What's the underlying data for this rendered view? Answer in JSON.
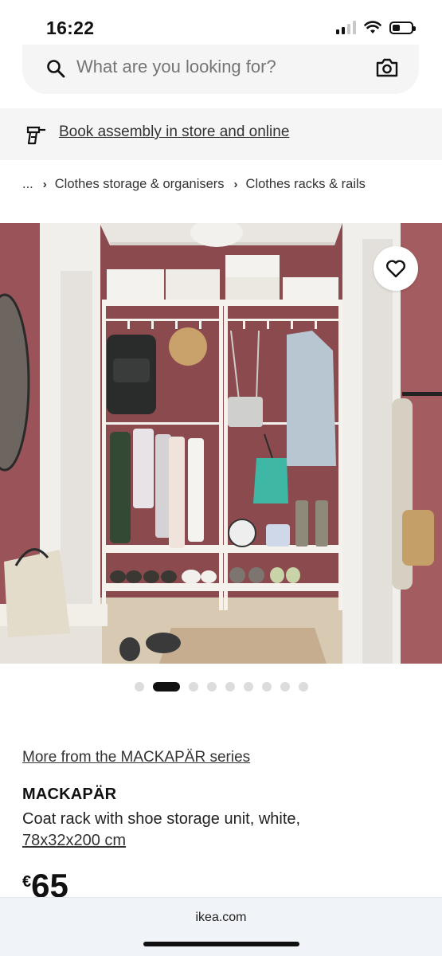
{
  "status_bar": {
    "time": "16:22",
    "icons": [
      "cellular-signal-icon",
      "wifi-icon",
      "battery-icon"
    ]
  },
  "search": {
    "placeholder": "What are you looking for?",
    "value": "",
    "icons": [
      "search-icon",
      "camera-icon"
    ]
  },
  "banner": {
    "icon": "assembly-tool-icon",
    "link_text": "Book assembly in store and online"
  },
  "breadcrumb": {
    "items": [
      "...",
      "Clothes storage & organisers",
      "Clothes racks & rails"
    ]
  },
  "gallery": {
    "image_count": 9,
    "active_index": 1,
    "wishlist_icon": "heart-icon"
  },
  "product": {
    "series_link": "More from the MACKAPÄR series",
    "name": "MACKAPÄR",
    "description": "Coat rack with shoe storage unit, white,",
    "size": "78x32x200 cm",
    "price_currency": "€",
    "price_amount": "65"
  },
  "browser": {
    "domain": "ikea.com"
  },
  "colors": {
    "wall": "#8c4a4e",
    "rack": "#f4f1ec",
    "floor": "#d9cbb6",
    "accent_text": "#111111"
  }
}
